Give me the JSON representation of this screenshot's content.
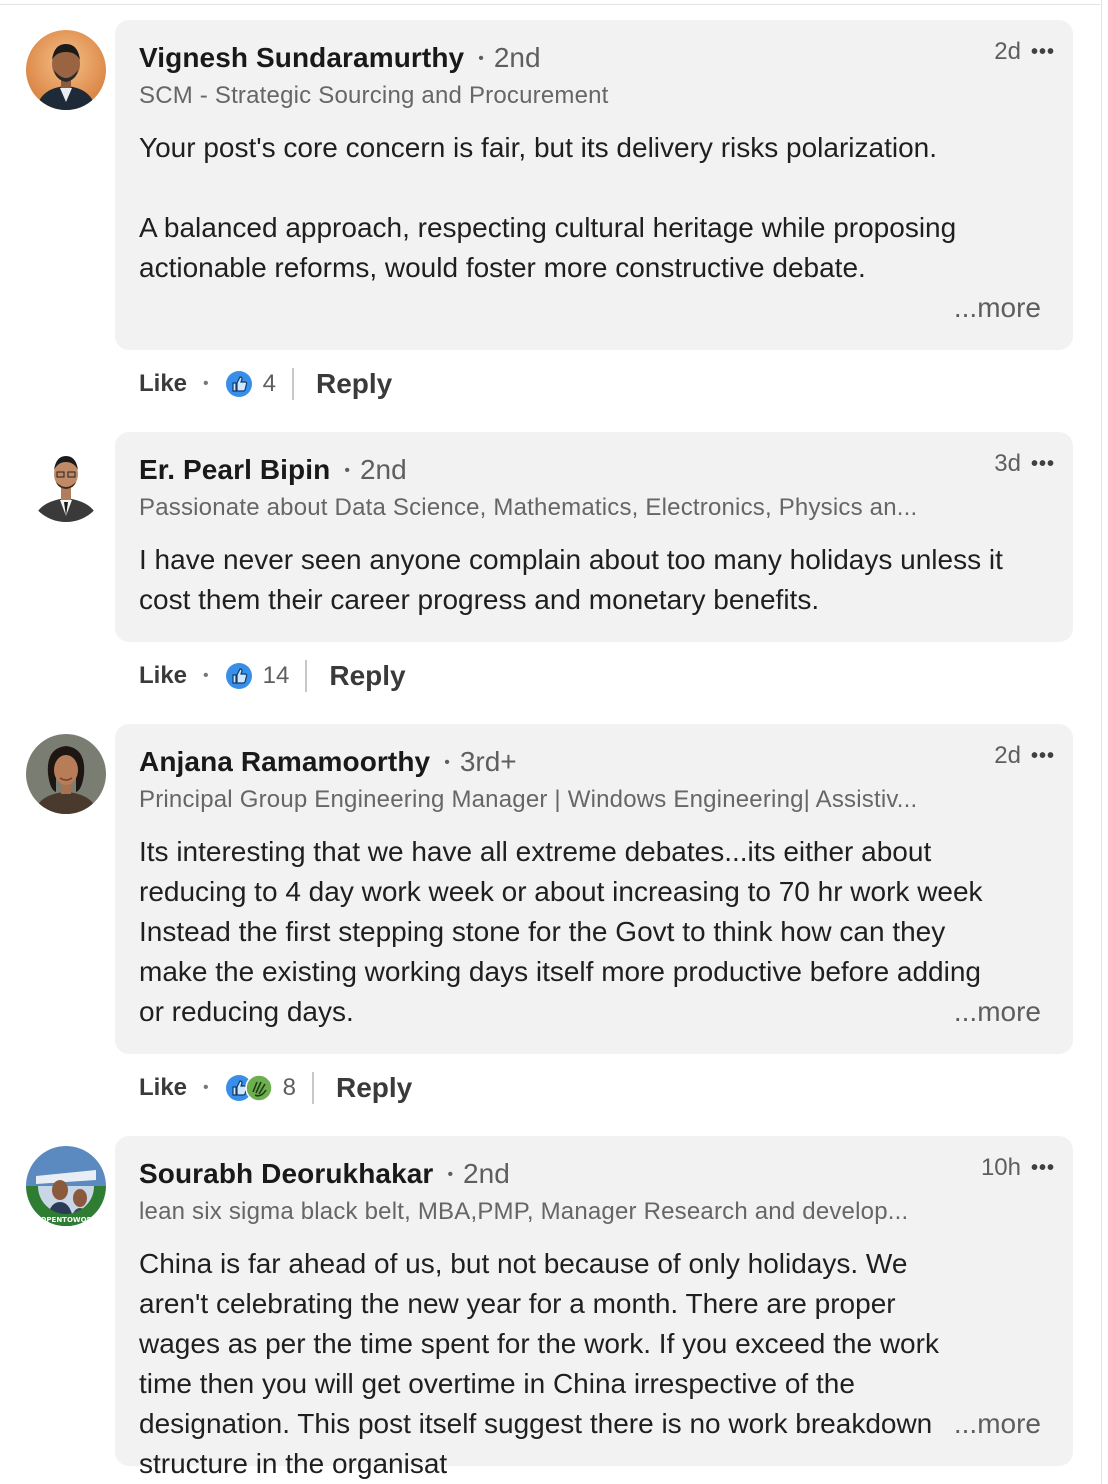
{
  "comments": [
    {
      "name": "Vignesh Sundaramurthy",
      "degree": "2nd",
      "time": "2d",
      "headline": "SCM - Strategic Sourcing and Procurement",
      "body": "Your post's core concern is fair, but its delivery risks polarization.\n\nA balanced approach, respecting cultural heritage while proposing actionable reforms, would foster more constructive debate.",
      "more": "...more",
      "like": "Like",
      "reactions": "4",
      "reply": "Reply"
    },
    {
      "name": "Er. Pearl Bipin",
      "degree": "2nd",
      "time": "3d",
      "headline": "Passionate about Data Science, Mathematics, Electronics, Physics an...",
      "body": "I have never seen anyone complain about too many holidays unless it cost them their career progress and monetary benefits.",
      "like": "Like",
      "reactions": "14",
      "reply": "Reply"
    },
    {
      "name": "Anjana Ramamoorthy",
      "degree": "3rd+",
      "time": "2d",
      "headline": "Principal Group Engineering Manager | Windows Engineering| Assistiv...",
      "body": "Its interesting that we have all extreme debates...its either about reducing to 4 day work week or about increasing to 70 hr work week Instead the first stepping stone for the Govt to think how can they make the existing working days itself more productive before adding or reducing days.",
      "more": "...more",
      "like": "Like",
      "reactions": "8",
      "reply": "Reply"
    },
    {
      "name": "Sourabh Deorukhakar",
      "degree": "2nd",
      "time": "10h",
      "headline": "lean six sigma black belt, MBA,PMP, Manager Research and develop...",
      "body": "China is far ahead of us, but not because of only holidays. We aren't celebrating the new year for a month. There are proper wages as per the time spent for the work. If you exceed the work time then you will get overtime in China irrespective of the designation. This post itself suggest there is no work breakdown structure in the organisat",
      "more": "...more",
      "avatar_badge": "#OPENTOWORK"
    }
  ],
  "icons": {
    "menu": "more-dots-icon",
    "like_reaction": "thumbs-up-icon",
    "support_reaction": "clapping-hands-icon"
  },
  "colors": {
    "bubble": "#f2f2f2",
    "like_blue": "#378fe9",
    "support_green": "#44712e",
    "open_to_work": "#2e7d32"
  }
}
